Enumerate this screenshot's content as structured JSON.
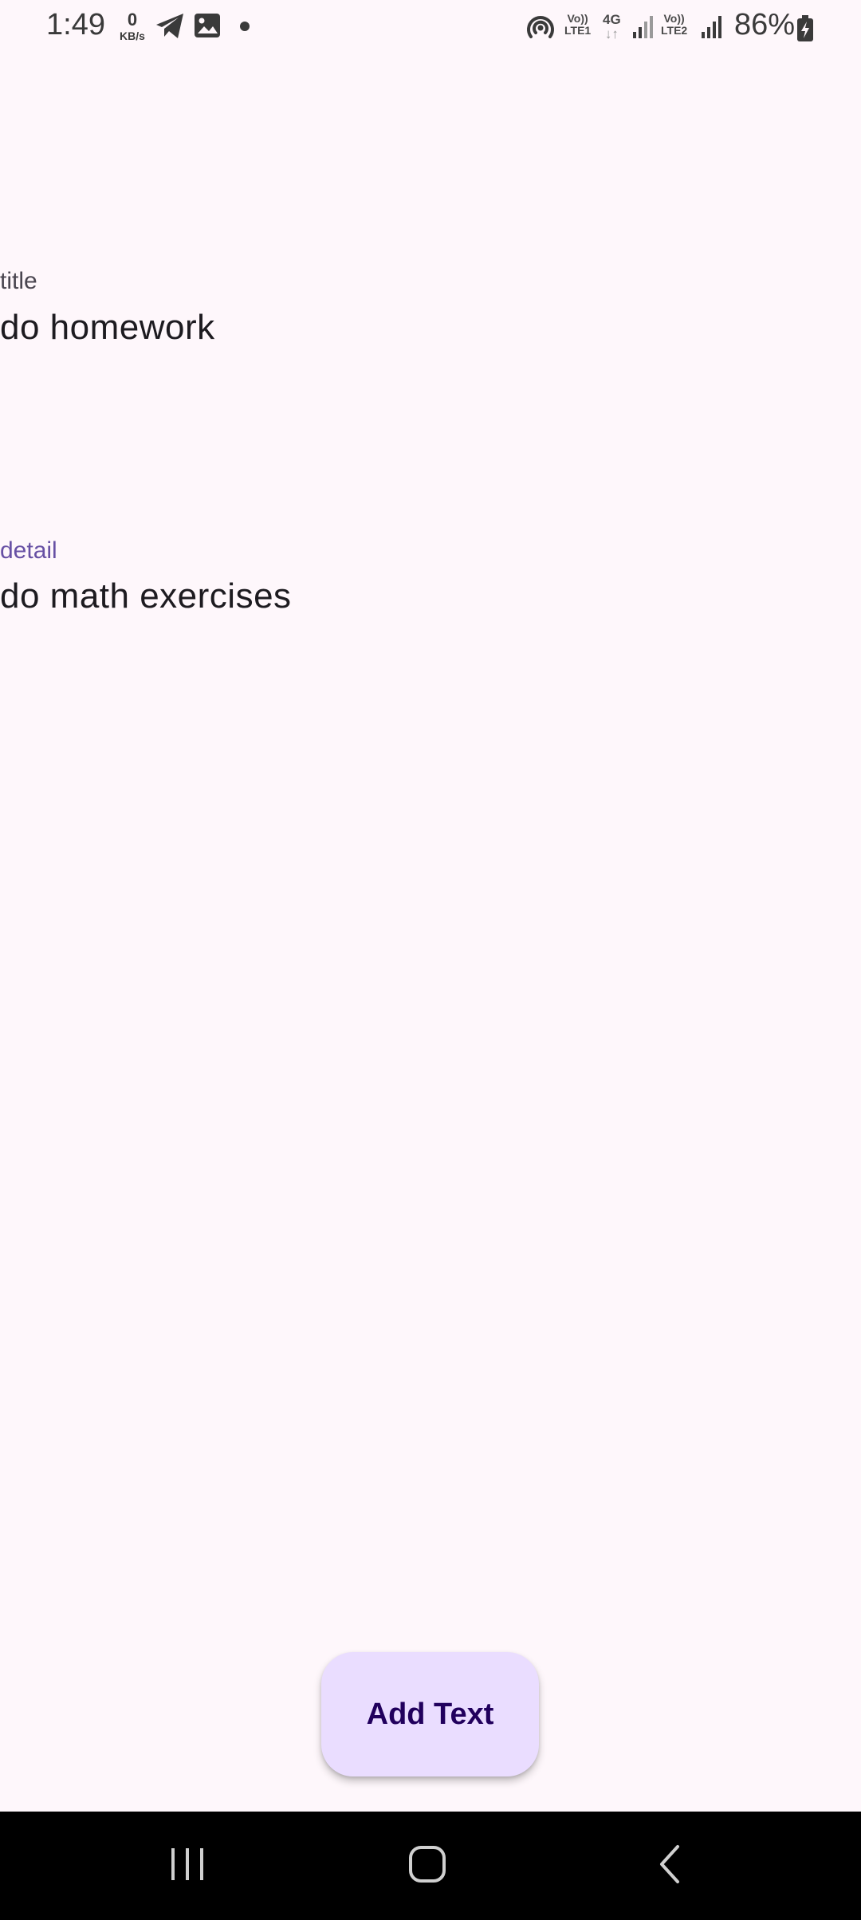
{
  "status_bar": {
    "time": "1:49",
    "network_speed_value": "0",
    "network_speed_unit": "KB/s",
    "sim1_label_top": "Vo))",
    "sim1_label_bottom": "LTE1",
    "network_type": "4G",
    "sim2_label_top": "Vo))",
    "sim2_label_bottom": "LTE2",
    "battery_percent": "86%",
    "icons": [
      "telegram-icon",
      "gallery-icon",
      "notification-dot-icon",
      "hotspot-icon",
      "signal-icon",
      "battery-charging-icon"
    ]
  },
  "form": {
    "title_label": "title",
    "title_value": "do homework",
    "detail_label": "detail",
    "detail_value": "do math exercises"
  },
  "fab": {
    "label": "Add Text"
  },
  "nav_bar": {
    "buttons": [
      "recent-apps-icon",
      "home-icon",
      "back-icon"
    ]
  },
  "colors": {
    "background": "#fef7fb",
    "accent": "#6750a4",
    "fab_background": "#eaddff",
    "fab_text": "#21005d",
    "nav_background": "#000000"
  }
}
